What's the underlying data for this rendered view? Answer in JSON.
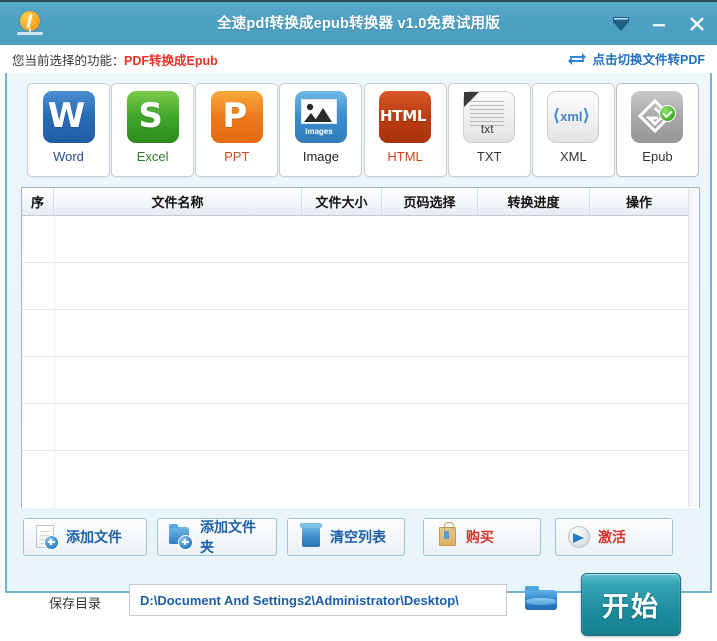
{
  "window": {
    "title": "全速pdf转换成epub转换器 v1.0免费试用版",
    "logo_icon": "app-logo-icon",
    "controls": {
      "collapse": "collapse-icon",
      "minimize": "minimize-icon",
      "close": "close-icon"
    }
  },
  "function_bar": {
    "label": "您当前选择的功能：",
    "value": "PDF转换成Epub",
    "switch_link": "点击切换文件转PDF",
    "switch_icon": "swap-arrows-icon"
  },
  "formats": [
    {
      "id": "word",
      "label": "Word",
      "glyph": "W",
      "icon": "word-icon",
      "selected": false
    },
    {
      "id": "excel",
      "label": "Excel",
      "glyph": "S",
      "icon": "excel-icon",
      "selected": false
    },
    {
      "id": "ppt",
      "label": "PPT",
      "glyph": "P",
      "icon": "ppt-icon",
      "selected": false
    },
    {
      "id": "image",
      "label": "Image",
      "glyph": "images",
      "icon": "image-icon",
      "selected": false
    },
    {
      "id": "html",
      "label": "HTML",
      "glyph": "HTML",
      "icon": "html-icon",
      "selected": false
    },
    {
      "id": "txt",
      "label": "TXT",
      "glyph": "txt",
      "icon": "txt-icon",
      "selected": false
    },
    {
      "id": "xml",
      "label": "XML",
      "glyph": "xml",
      "icon": "xml-icon",
      "selected": false
    },
    {
      "id": "epub",
      "label": "Epub",
      "glyph": "e",
      "icon": "epub-icon",
      "selected": true
    }
  ],
  "table": {
    "headers": [
      "序",
      "文件名称",
      "文件大小",
      "页码选择",
      "转换进度",
      "操作"
    ],
    "rows": []
  },
  "actions": [
    {
      "id": "add-file",
      "label": "添加文件",
      "icon": "document-plus-icon",
      "color": "blue"
    },
    {
      "id": "add-folder",
      "label": "添加文件夹",
      "icon": "folder-plus-icon",
      "color": "blue"
    },
    {
      "id": "clear-list",
      "label": "清空列表",
      "icon": "trash-bin-icon",
      "color": "blue"
    },
    {
      "id": "buy",
      "label": "购买",
      "icon": "shopping-bag-icon",
      "color": "red"
    },
    {
      "id": "activate",
      "label": "激活",
      "icon": "arrow-circle-icon",
      "color": "red"
    }
  ],
  "save": {
    "label": "保存目录",
    "path": "D:\\Document And Settings2\\Administrator\\Desktop\\",
    "placeholder": "D:\\Document And Settings2\\Administrator\\Desktop\\",
    "browse_icon": "folder-browse-icon",
    "start_label": "开始"
  },
  "colors": {
    "titlebar": "#4ea1c2",
    "panel_border": "#74b4d2",
    "accent_red": "#e8342a",
    "accent_link": "#1f6fc4",
    "start_button": "#1b8c9e",
    "selected_check": "#3fae2a"
  }
}
